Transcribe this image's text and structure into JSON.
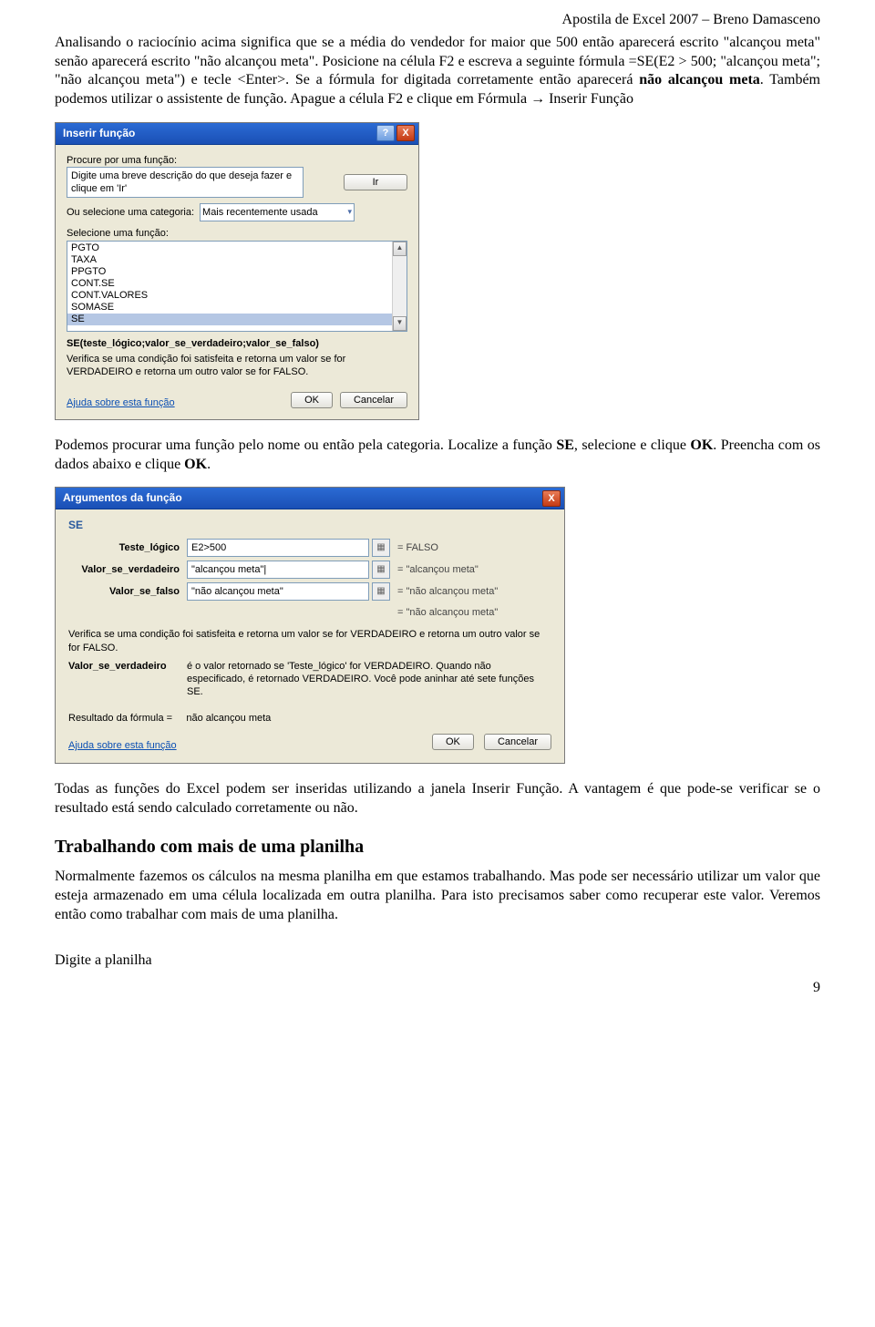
{
  "header": {
    "right": "Apostila de Excel 2007 – Breno Damasceno"
  },
  "para1_a": "Analisando o raciocínio acima significa que se a média do vendedor for maior que 500 então aparecerá escrito \"alcançou meta\" senão aparecerá escrito \"não alcançou meta\". Posicione na célula F2 e escreva a seguinte fórmula =SE(E2 > 500; \"alcançou meta\"; \"não alcançou meta\") e tecle <Enter>. Se a fórmula for digitada corretamente então aparecerá ",
  "para1_bold": "não alcançou meta",
  "para1_b": ". Também podemos utilizar o assistente de função. Apague a célula F2 e clique em Fórmula ",
  "para1_arrow": "→",
  "para1_c": " Inserir Função",
  "dialog1": {
    "title": "Inserir função",
    "help": "?",
    "close": "X",
    "search_label_html": "Procure por uma função:",
    "search_u": "P",
    "desc_value": "Digite uma breve descrição do que deseja fazer e clique em 'Ir'",
    "go": "Ir",
    "go_u": "I",
    "cat_label": "Ou selecione uma categoria:",
    "cat_u": "c",
    "cat_value": "Mais recentemente usada",
    "select_label": "Selecione uma função:",
    "select_u": "N",
    "items": [
      "PGTO",
      "TAXA",
      "PPGTO",
      "CONT.SE",
      "CONT.VALORES",
      "SOMASE",
      "SE"
    ],
    "selected": "SE",
    "syntax": "SE(teste_lógico;valor_se_verdadeiro;valor_se_falso)",
    "syntax_desc": "Verifica se uma condição foi satisfeita e retorna um valor se for VERDADEIRO e retorna um outro valor se for FALSO.",
    "help_link": "Ajuda sobre esta função",
    "ok": "OK",
    "cancel": "Cancelar"
  },
  "para2_a": "Podemos procurar uma função pelo nome ou então pela categoria. Localize a função ",
  "para2_b1": "SE",
  "para2_c": ", selecione e clique ",
  "para2_b2": "OK",
  "para2_d": ". Preencha com os dados abaixo e clique ",
  "para2_b3": "OK",
  "para2_e": ".",
  "dialog2": {
    "title": "Argumentos da função",
    "close": "X",
    "fn": "SE",
    "arg1_label": "Teste_lógico",
    "arg1_val": "E2>500",
    "arg1_res": "= FALSO",
    "arg2_label": "Valor_se_verdadeiro",
    "arg2_val": "\"alcançou meta\"|",
    "arg2_res": "= \"alcançou meta\"",
    "arg3_label": "Valor_se_falso",
    "arg3_val": "\"não alcançou meta\"",
    "arg3_res": "= \"não alcançou meta\"",
    "overall_res": "= \"não alcançou meta\"",
    "desc": "Verifica se uma condição foi satisfeita e retorna um valor se for VERDADEIRO e retorna um outro valor se for FALSO.",
    "val_label": "Valor_se_verdadeiro",
    "val_desc": "é o valor retornado se 'Teste_lógico' for VERDADEIRO. Quando não especificado, é retornado VERDADEIRO. Você pode aninhar até sete funções SE.",
    "result_label": "Resultado da fórmula =",
    "result_val": "não alcançou meta",
    "help_link": "Ajuda sobre esta função",
    "ok": "OK",
    "cancel": "Cancelar"
  },
  "para3": "Todas as funções do Excel podem ser inseridas utilizando a janela Inserir Função. A vantagem é que pode-se verificar se o resultado está sendo calculado corretamente ou não.",
  "section_heading": "Trabalhando com mais de uma planilha",
  "para4": "Normalmente fazemos os cálculos na mesma planilha em que estamos trabalhando. Mas pode ser necessário utilizar um valor que esteja armazenado em uma célula localizada em outra planilha. Para isto precisamos saber como recuperar este valor. Veremos então como trabalhar com mais de uma planilha.",
  "para5": "Digite a planilha",
  "page_number": "9"
}
